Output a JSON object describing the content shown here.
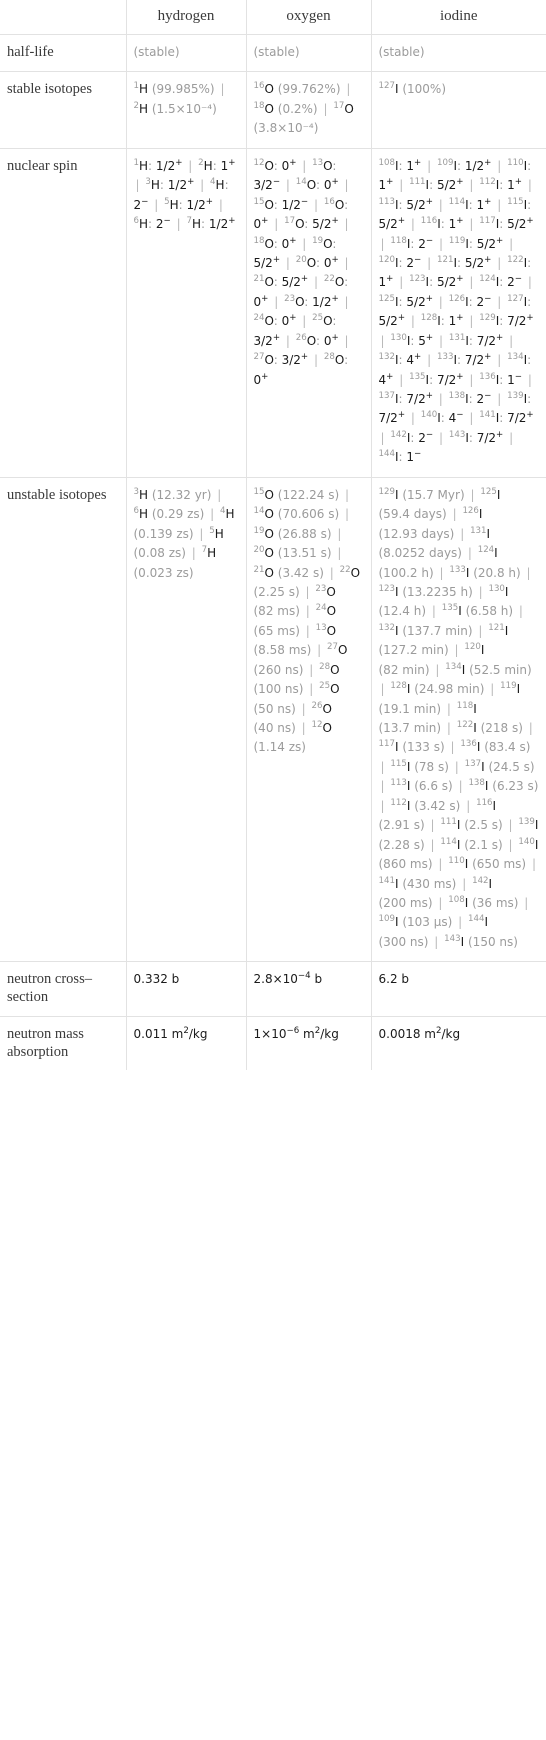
{
  "table": {
    "columns": [
      "",
      "hydrogen",
      "oxygen",
      "iodine"
    ],
    "row_labels": {
      "half_life": "half-life",
      "stable_isotopes": "stable isotopes",
      "nuclear_spin": "nuclear spin",
      "unstable_isotopes": "unstable isotopes",
      "neutron_cross_section": "neutron cross–section",
      "neutron_mass_absorption": "neutron mass absorption"
    },
    "half_life": {
      "hydrogen": "(stable)",
      "oxygen": "(stable)",
      "iodine": "(stable)"
    },
    "stable_isotopes": {
      "hydrogen": [
        {
          "mass": "1",
          "sym": "H",
          "note": "(99.985%)"
        },
        {
          "mass": "2",
          "sym": "H",
          "note": "(1.5×10⁻⁴)"
        }
      ],
      "oxygen": [
        {
          "mass": "16",
          "sym": "O",
          "note": "(99.762%)"
        },
        {
          "mass": "18",
          "sym": "O",
          "note": "(0.2%)"
        },
        {
          "mass": "17",
          "sym": "O",
          "note": "(3.8×10⁻⁴)"
        }
      ],
      "iodine": [
        {
          "mass": "127",
          "sym": "I",
          "note": "(100%)"
        }
      ]
    },
    "nuclear_spin": {
      "hydrogen": [
        {
          "mass": "1",
          "sym": "H",
          "spin": "1/2⁺"
        },
        {
          "mass": "2",
          "sym": "H",
          "spin": "1⁺"
        },
        {
          "mass": "3",
          "sym": "H",
          "spin": "1/2⁺"
        },
        {
          "mass": "4",
          "sym": "H",
          "spin": "2⁻"
        },
        {
          "mass": "5",
          "sym": "H",
          "spin": "1/2⁺"
        },
        {
          "mass": "6",
          "sym": "H",
          "spin": "2⁻"
        },
        {
          "mass": "7",
          "sym": "H",
          "spin": "1/2⁺"
        }
      ],
      "oxygen": [
        {
          "mass": "12",
          "sym": "O",
          "spin": "0⁺"
        },
        {
          "mass": "13",
          "sym": "O",
          "spin": "3/2⁻"
        },
        {
          "mass": "14",
          "sym": "O",
          "spin": "0⁺"
        },
        {
          "mass": "15",
          "sym": "O",
          "spin": "1/2⁻"
        },
        {
          "mass": "16",
          "sym": "O",
          "spin": "0⁺"
        },
        {
          "mass": "17",
          "sym": "O",
          "spin": "5/2⁺"
        },
        {
          "mass": "18",
          "sym": "O",
          "spin": "0⁺"
        },
        {
          "mass": "19",
          "sym": "O",
          "spin": "5/2⁺"
        },
        {
          "mass": "20",
          "sym": "O",
          "spin": "0⁺"
        },
        {
          "mass": "21",
          "sym": "O",
          "spin": "5/2⁺"
        },
        {
          "mass": "22",
          "sym": "O",
          "spin": "0⁺"
        },
        {
          "mass": "23",
          "sym": "O",
          "spin": "1/2⁺"
        },
        {
          "mass": "24",
          "sym": "O",
          "spin": "0⁺"
        },
        {
          "mass": "25",
          "sym": "O",
          "spin": "3/2⁺"
        },
        {
          "mass": "26",
          "sym": "O",
          "spin": "0⁺"
        },
        {
          "mass": "27",
          "sym": "O",
          "spin": "3/2⁺"
        },
        {
          "mass": "28",
          "sym": "O",
          "spin": "0⁺"
        }
      ],
      "iodine": [
        {
          "mass": "108",
          "sym": "I",
          "spin": "1⁺"
        },
        {
          "mass": "109",
          "sym": "I",
          "spin": "1/2⁺"
        },
        {
          "mass": "110",
          "sym": "I",
          "spin": "1⁺"
        },
        {
          "mass": "111",
          "sym": "I",
          "spin": "5/2⁺"
        },
        {
          "mass": "112",
          "sym": "I",
          "spin": "1⁺"
        },
        {
          "mass": "113",
          "sym": "I",
          "spin": "5/2⁺"
        },
        {
          "mass": "114",
          "sym": "I",
          "spin": "1⁺"
        },
        {
          "mass": "115",
          "sym": "I",
          "spin": "5/2⁺"
        },
        {
          "mass": "116",
          "sym": "I",
          "spin": "1⁺"
        },
        {
          "mass": "117",
          "sym": "I",
          "spin": "5/2⁺"
        },
        {
          "mass": "118",
          "sym": "I",
          "spin": "2⁻"
        },
        {
          "mass": "119",
          "sym": "I",
          "spin": "5/2⁺"
        },
        {
          "mass": "120",
          "sym": "I",
          "spin": "2⁻"
        },
        {
          "mass": "121",
          "sym": "I",
          "spin": "5/2⁺"
        },
        {
          "mass": "122",
          "sym": "I",
          "spin": "1⁺"
        },
        {
          "mass": "123",
          "sym": "I",
          "spin": "5/2⁺"
        },
        {
          "mass": "124",
          "sym": "I",
          "spin": "2⁻"
        },
        {
          "mass": "125",
          "sym": "I",
          "spin": "5/2⁺"
        },
        {
          "mass": "126",
          "sym": "I",
          "spin": "2⁻"
        },
        {
          "mass": "127",
          "sym": "I",
          "spin": "5/2⁺"
        },
        {
          "mass": "128",
          "sym": "I",
          "spin": "1⁺"
        },
        {
          "mass": "129",
          "sym": "I",
          "spin": "7/2⁺"
        },
        {
          "mass": "130",
          "sym": "I",
          "spin": "5⁺"
        },
        {
          "mass": "131",
          "sym": "I",
          "spin": "7/2⁺"
        },
        {
          "mass": "132",
          "sym": "I",
          "spin": "4⁺"
        },
        {
          "mass": "133",
          "sym": "I",
          "spin": "7/2⁺"
        },
        {
          "mass": "134",
          "sym": "I",
          "spin": "4⁺"
        },
        {
          "mass": "135",
          "sym": "I",
          "spin": "7/2⁺"
        },
        {
          "mass": "136",
          "sym": "I",
          "spin": "1⁻"
        },
        {
          "mass": "137",
          "sym": "I",
          "spin": "7/2⁺"
        },
        {
          "mass": "138",
          "sym": "I",
          "spin": "2⁻"
        },
        {
          "mass": "139",
          "sym": "I",
          "spin": "7/2⁺"
        },
        {
          "mass": "140",
          "sym": "I",
          "spin": "4⁻"
        },
        {
          "mass": "141",
          "sym": "I",
          "spin": "7/2⁺"
        },
        {
          "mass": "142",
          "sym": "I",
          "spin": "2⁻"
        },
        {
          "mass": "143",
          "sym": "I",
          "spin": "7/2⁺"
        },
        {
          "mass": "144",
          "sym": "I",
          "spin": "1⁻"
        }
      ]
    },
    "unstable_isotopes": {
      "hydrogen": [
        {
          "mass": "3",
          "sym": "H",
          "half_life": "(12.32 yr)"
        },
        {
          "mass": "6",
          "sym": "H",
          "half_life": "(0.29 zs)"
        },
        {
          "mass": "4",
          "sym": "H",
          "half_life": "(0.139 zs)"
        },
        {
          "mass": "5",
          "sym": "H",
          "half_life": "(0.08 zs)"
        },
        {
          "mass": "7",
          "sym": "H",
          "half_life": "(0.023 zs)"
        }
      ],
      "oxygen": [
        {
          "mass": "15",
          "sym": "O",
          "half_life": "(122.24 s)"
        },
        {
          "mass": "14",
          "sym": "O",
          "half_life": "(70.606 s)"
        },
        {
          "mass": "19",
          "sym": "O",
          "half_life": "(26.88 s)"
        },
        {
          "mass": "20",
          "sym": "O",
          "half_life": "(13.51 s)"
        },
        {
          "mass": "21",
          "sym": "O",
          "half_life": "(3.42 s)"
        },
        {
          "mass": "22",
          "sym": "O",
          "half_life": "(2.25 s)"
        },
        {
          "mass": "23",
          "sym": "O",
          "half_life": "(82 ms)"
        },
        {
          "mass": "24",
          "sym": "O",
          "half_life": "(65 ms)"
        },
        {
          "mass": "13",
          "sym": "O",
          "half_life": "(8.58 ms)"
        },
        {
          "mass": "27",
          "sym": "O",
          "half_life": "(260 ns)"
        },
        {
          "mass": "28",
          "sym": "O",
          "half_life": "(100 ns)"
        },
        {
          "mass": "25",
          "sym": "O",
          "half_life": "(50 ns)"
        },
        {
          "mass": "26",
          "sym": "O",
          "half_life": "(40 ns)"
        },
        {
          "mass": "12",
          "sym": "O",
          "half_life": "(1.14 zs)"
        }
      ],
      "iodine": [
        {
          "mass": "129",
          "sym": "I",
          "half_life": "(15.7 Myr)"
        },
        {
          "mass": "125",
          "sym": "I",
          "half_life": "(59.4 days)"
        },
        {
          "mass": "126",
          "sym": "I",
          "half_life": "(12.93 days)"
        },
        {
          "mass": "131",
          "sym": "I",
          "half_life": "(8.0252 days)"
        },
        {
          "mass": "124",
          "sym": "I",
          "half_life": "(100.2 h)"
        },
        {
          "mass": "133",
          "sym": "I",
          "half_life": "(20.8 h)"
        },
        {
          "mass": "123",
          "sym": "I",
          "half_life": "(13.2235 h)"
        },
        {
          "mass": "130",
          "sym": "I",
          "half_life": "(12.4 h)"
        },
        {
          "mass": "135",
          "sym": "I",
          "half_life": "(6.58 h)"
        },
        {
          "mass": "132",
          "sym": "I",
          "half_life": "(137.7 min)"
        },
        {
          "mass": "121",
          "sym": "I",
          "half_life": "(127.2 min)"
        },
        {
          "mass": "120",
          "sym": "I",
          "half_life": "(82 min)"
        },
        {
          "mass": "134",
          "sym": "I",
          "half_life": "(52.5 min)"
        },
        {
          "mass": "128",
          "sym": "I",
          "half_life": "(24.98 min)"
        },
        {
          "mass": "119",
          "sym": "I",
          "half_life": "(19.1 min)"
        },
        {
          "mass": "118",
          "sym": "I",
          "half_life": "(13.7 min)"
        },
        {
          "mass": "122",
          "sym": "I",
          "half_life": "(218 s)"
        },
        {
          "mass": "117",
          "sym": "I",
          "half_life": "(133 s)"
        },
        {
          "mass": "136",
          "sym": "I",
          "half_life": "(83.4 s)"
        },
        {
          "mass": "115",
          "sym": "I",
          "half_life": "(78 s)"
        },
        {
          "mass": "137",
          "sym": "I",
          "half_life": "(24.5 s)"
        },
        {
          "mass": "113",
          "sym": "I",
          "half_life": "(6.6 s)"
        },
        {
          "mass": "138",
          "sym": "I",
          "half_life": "(6.23 s)"
        },
        {
          "mass": "112",
          "sym": "I",
          "half_life": "(3.42 s)"
        },
        {
          "mass": "116",
          "sym": "I",
          "half_life": "(2.91 s)"
        },
        {
          "mass": "111",
          "sym": "I",
          "half_life": "(2.5 s)"
        },
        {
          "mass": "139",
          "sym": "I",
          "half_life": "(2.28 s)"
        },
        {
          "mass": "114",
          "sym": "I",
          "half_life": "(2.1 s)"
        },
        {
          "mass": "140",
          "sym": "I",
          "half_life": "(860 ms)"
        },
        {
          "mass": "110",
          "sym": "I",
          "half_life": "(650 ms)"
        },
        {
          "mass": "141",
          "sym": "I",
          "half_life": "(430 ms)"
        },
        {
          "mass": "142",
          "sym": "I",
          "half_life": "(200 ms)"
        },
        {
          "mass": "108",
          "sym": "I",
          "half_life": "(36 ms)"
        },
        {
          "mass": "109",
          "sym": "I",
          "half_life": "(103 µs)"
        },
        {
          "mass": "144",
          "sym": "I",
          "half_life": "(300 ns)"
        },
        {
          "mass": "143",
          "sym": "I",
          "half_life": "(150 ns)"
        }
      ]
    },
    "neutron_cross_section": {
      "hydrogen": "0.332 b",
      "oxygen": "2.8×10⁻⁴ b",
      "iodine": "6.2 b"
    },
    "neutron_mass_absorption": {
      "hydrogen": "0.011 m²/kg",
      "oxygen": "1×10⁻⁶ m²/kg",
      "iodine": "0.0018 m²/kg"
    }
  }
}
